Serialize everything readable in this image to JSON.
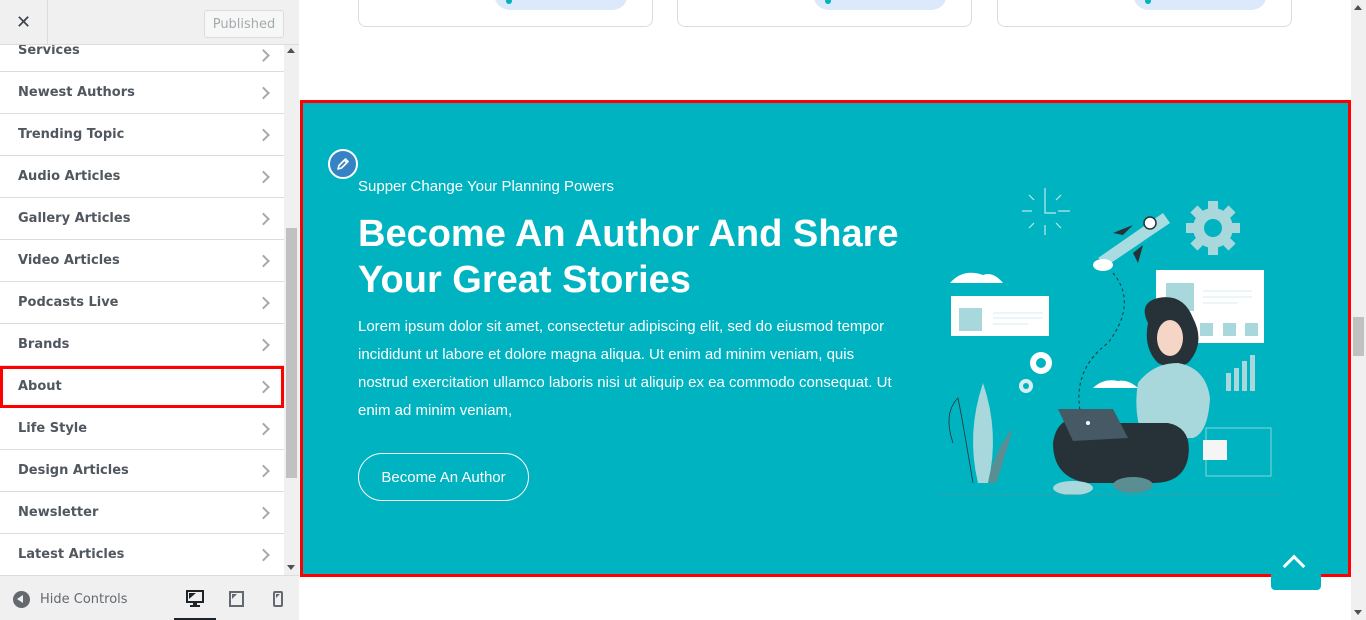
{
  "sidebar": {
    "header": {
      "close_icon": "close-icon",
      "publish_label": "Published"
    },
    "sections": [
      {
        "label": "Services"
      },
      {
        "label": "Newest Authors"
      },
      {
        "label": "Trending Topic"
      },
      {
        "label": "Audio Articles"
      },
      {
        "label": "Gallery Articles"
      },
      {
        "label": "Video Articles"
      },
      {
        "label": "Podcasts Live"
      },
      {
        "label": "Brands"
      },
      {
        "label": "About",
        "highlighted": true
      },
      {
        "label": "Life Style"
      },
      {
        "label": "Design Articles"
      },
      {
        "label": "Newsletter"
      },
      {
        "label": "Latest Articles"
      }
    ],
    "footer": {
      "hide_controls_label": "Hide Controls",
      "devices": [
        {
          "name": "desktop",
          "icon": "desktop-icon",
          "active": true
        },
        {
          "name": "tablet",
          "icon": "tablet-icon",
          "active": false
        },
        {
          "name": "mobile",
          "icon": "mobile-icon",
          "active": false
        }
      ]
    }
  },
  "preview": {
    "author_section": {
      "subtitle": "Supper Change Your Planning Powers",
      "headline": "Become An Author And Share Your Great Stories",
      "body": "Lorem ipsum dolor sit amet, consectetur adipiscing elit, sed do eiusmod tempor incididunt ut labore et dolore magna aliqua. Ut enim ad minim veniam, quis nostrud exercitation ullamco laboris nisi ut aliquip ex ea commodo consequat. Ut enim ad minim veniam,",
      "cta_label": "Become An Author",
      "edit_icon": "pencil-icon",
      "illustration": "woman-with-laptop-illustration"
    },
    "back_to_top_icon": "chevron-up-icon"
  },
  "colors": {
    "section_bg": "#00b3c0",
    "highlight_outline": "#ff0000",
    "edit_button": "#3582c4",
    "pill_bg": "#dbe9fb"
  }
}
